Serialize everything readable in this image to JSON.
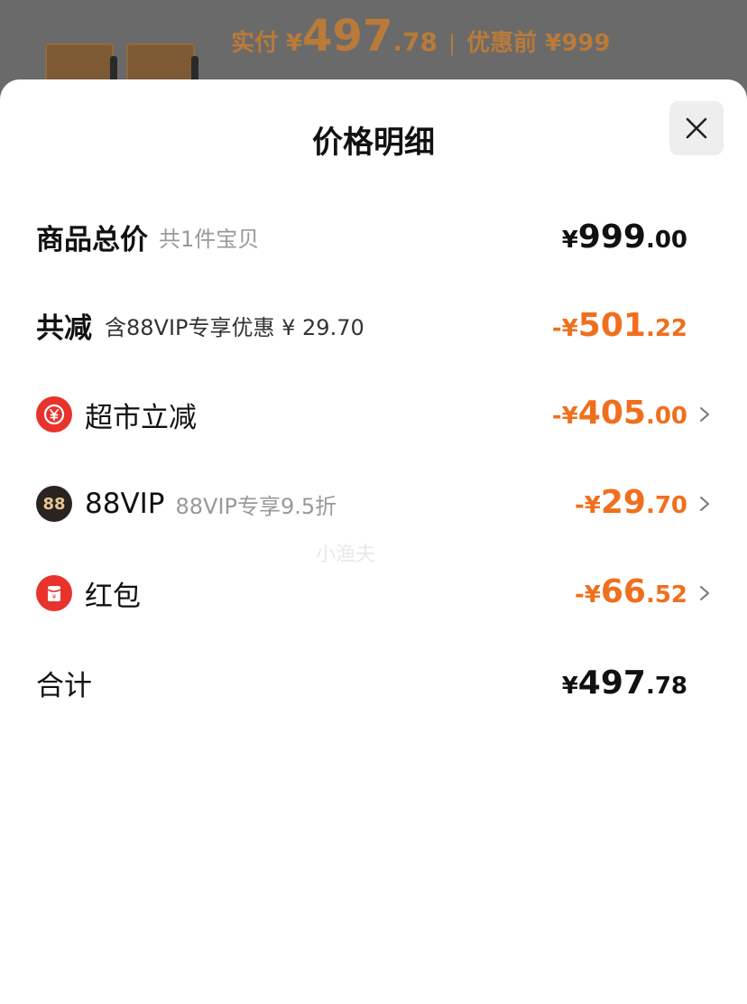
{
  "backdrop": {
    "paid_label": "实付 ¥",
    "paid_int": "497",
    "paid_dec": ".78",
    "separator": "|",
    "original_label": "优惠前 ¥999"
  },
  "sheet": {
    "title": "价格明细",
    "close_icon": "close-icon"
  },
  "rows": {
    "subtotal": {
      "label": "商品总价",
      "sub": "共1件宝贝",
      "sym": "¥",
      "int": "999",
      "dec": ".00"
    },
    "discount_total": {
      "label": "共减",
      "sub": "含88VIP专享优惠 ¥ 29.70",
      "sym": "-¥",
      "int": "501",
      "dec": ".22"
    },
    "supermarket": {
      "icon": "yen-icon",
      "label": "超市立减",
      "sym": "-¥",
      "int": "405",
      "dec": ".00"
    },
    "vip": {
      "icon_text": "88",
      "label": "88VIP",
      "sub": "88VIP专享9.5折",
      "sym": "-¥",
      "int": "29",
      "dec": ".70"
    },
    "redpacket": {
      "icon": "red-packet-icon",
      "label": "红包",
      "sym": "-¥",
      "int": "66",
      "dec": ".52"
    },
    "total": {
      "label": "合计",
      "sym": "¥",
      "int": "497",
      "dec": ".78"
    }
  },
  "watermark": "小渔夫",
  "colors": {
    "discount": "#f06f1e",
    "icon_red": "#e8332c",
    "text": "#111111"
  }
}
